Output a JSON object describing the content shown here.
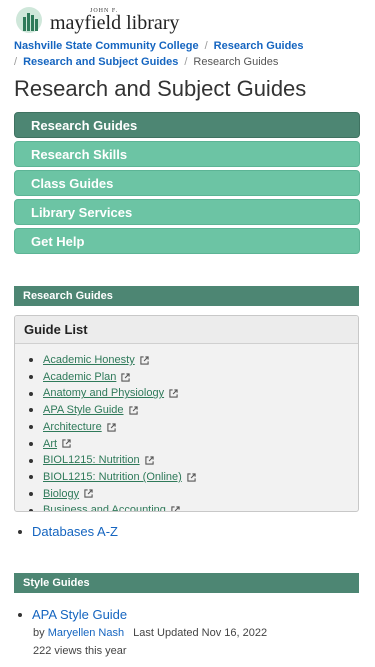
{
  "logo": {
    "top_text": "JOHN F.",
    "name": "mayfield library"
  },
  "breadcrumb": {
    "items": [
      "Nashville State Community College",
      "Research Guides",
      "Research and Subject Guides"
    ],
    "current": "Research Guides"
  },
  "page_title": "Research and Subject Guides",
  "nav": {
    "items": [
      "Research Guides",
      "Research Skills",
      "Class Guides",
      "Library Services",
      "Get Help"
    ]
  },
  "research_box": {
    "title": "Research Guides"
  },
  "guide_list": {
    "title": "Guide List",
    "items": [
      "Academic Honesty",
      "Academic Plan",
      "Anatomy and Physiology",
      "APA Style Guide",
      "Architecture",
      "Art",
      "BIOL1215: Nutrition",
      "BIOL1215: Nutrition (Online)",
      "Biology",
      "Business and Accounting"
    ]
  },
  "databases_link": "Databases A-Z",
  "style_box": {
    "title": "Style Guides"
  },
  "style_guide": {
    "link": "APA Style Guide",
    "by": "by",
    "author": "Maryellen Nash",
    "updated": "Last Updated Nov 16, 2022",
    "views": "222 views this year"
  },
  "colors": {
    "nav_active": "#4d8673",
    "nav_item": "#6cc4a4",
    "link": "#1565c0",
    "guide_link": "#2f7a5a"
  }
}
